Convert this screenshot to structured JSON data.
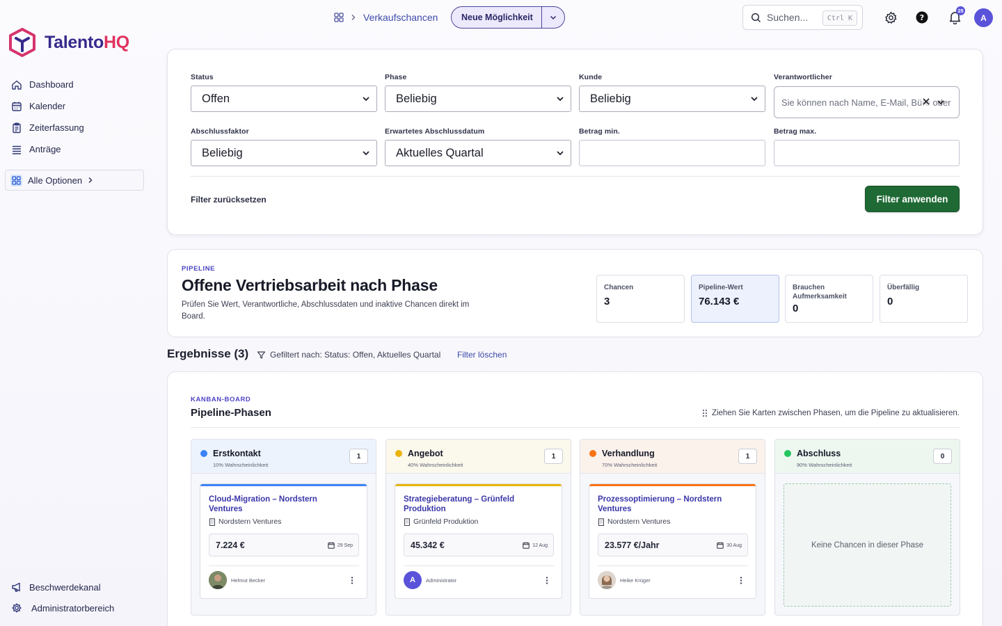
{
  "app": {
    "logo_part1": "Talento",
    "logo_part2": "HQ"
  },
  "sidebar": {
    "items": [
      {
        "label": "Dashboard",
        "icon": "home-icon"
      },
      {
        "label": "Kalender",
        "icon": "calendar-icon"
      },
      {
        "label": "Zeiterfassung",
        "icon": "clipboard-icon"
      },
      {
        "label": "Anträge",
        "icon": "list-icon"
      }
    ],
    "all_options": "Alle Optionen",
    "bottom": [
      {
        "label": "Beschwerdekanal",
        "icon": "megaphone-icon"
      },
      {
        "label": "Administratorbereich",
        "icon": "gear-icon"
      }
    ]
  },
  "header": {
    "breadcrumb": "Verkaufschancen",
    "new_button": "Neue Möglichkeit",
    "search_placeholder": "Suchen...",
    "search_shortcut": "Ctrl K",
    "notification_count": "25",
    "avatar_initial": "A"
  },
  "filters": {
    "status": {
      "label": "Status",
      "value": "Offen"
    },
    "phase": {
      "label": "Phase",
      "value": "Beliebig"
    },
    "kunde": {
      "label": "Kunde",
      "value": "Beliebig"
    },
    "verantwortlicher": {
      "label": "Verantwortlicher",
      "placeholder": "Sie können nach Name, E-Mail, Büro oder"
    },
    "abschlussfaktor": {
      "label": "Abschlussfaktor",
      "value": "Beliebig"
    },
    "abschlussdatum": {
      "label": "Erwartetes Abschlussdatum",
      "value": "Aktuelles Quartal"
    },
    "betrag_min": {
      "label": "Betrag min.",
      "value": ""
    },
    "betrag_max": {
      "label": "Betrag max.",
      "value": ""
    },
    "reset_label": "Filter zurücksetzen",
    "apply_label": "Filter anwenden"
  },
  "pipeline": {
    "eyebrow": "PIPELINE",
    "title": "Offene Vertriebsarbeit nach Phase",
    "description": "Prüfen Sie Wert, Verantwortliche, Abschlussdaten und inaktive Chancen direkt im Board.",
    "stats": [
      {
        "label": "Chancen",
        "value": "3"
      },
      {
        "label": "Pipeline-Wert",
        "value": "76.143 €"
      },
      {
        "label": "Brauchen Aufmerksamkeit",
        "value": "0"
      },
      {
        "label": "Überfällig",
        "value": "0"
      }
    ]
  },
  "results": {
    "title": "Ergebnisse (3)",
    "filtered_by": "Gefiltert nach: Status: Offen, Aktuelles Quartal",
    "clear_filters": "Filter löschen"
  },
  "kanban": {
    "eyebrow": "KANBAN-BOARD",
    "title": "Pipeline-Phasen",
    "hint": "Ziehen Sie Karten zwischen Phasen, um die Pipeline zu aktualisieren.",
    "columns": [
      {
        "name": "Erstkontakt",
        "probability": "10% Wahrscheinlichkeit",
        "count": "1",
        "color": "#3b82f6",
        "deal": {
          "title": "Cloud-Migration – Nordstern Ventures",
          "company": "Nordstern Ventures",
          "amount": "7.224 €",
          "date": "29 Sep",
          "owner": "Helmut Becker"
        }
      },
      {
        "name": "Angebot",
        "probability": "40% Wahrscheinlichkeit",
        "count": "1",
        "color": "#eab308",
        "deal": {
          "title": "Strategieberatung – Grünfeld Produktion",
          "company": "Grünfeld Produktion",
          "amount": "45.342 €",
          "date": "12 Aug",
          "owner": "Administrator"
        }
      },
      {
        "name": "Verhandlung",
        "probability": "70% Wahrscheinlichkeit",
        "count": "1",
        "color": "#f97316",
        "deal": {
          "title": "Prozessoptimierung – Nordstern Ventures",
          "company": "Nordstern Ventures",
          "amount": "23.577 €/Jahr",
          "date": "30 Aug",
          "owner": "Heike Krüger"
        }
      },
      {
        "name": "Abschluss",
        "probability": "90% Wahrscheinlichkeit",
        "count": "0",
        "color": "#22c55e",
        "empty_text": "Keine Chancen in dieser Phase"
      }
    ]
  }
}
